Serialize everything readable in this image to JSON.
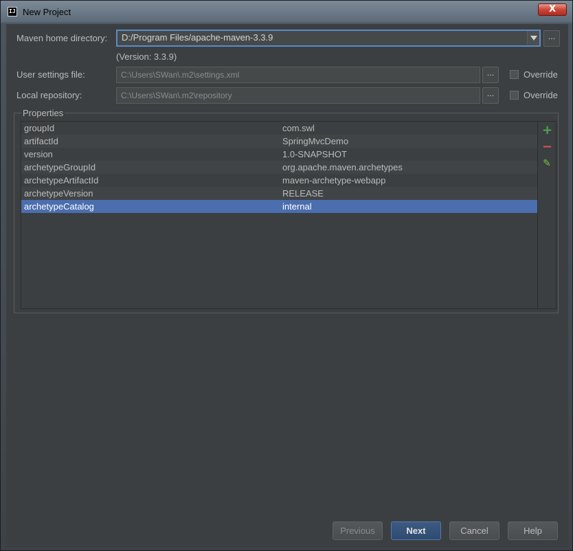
{
  "window": {
    "title": "New Project",
    "close_label": "X"
  },
  "maven_home": {
    "label": "Maven home directory:",
    "value": "D:/Program Files/apache-maven-3.3.9",
    "version": "(Version: 3.3.9)"
  },
  "user_settings": {
    "label": "User settings file:",
    "value": "C:\\Users\\SWan\\.m2\\settings.xml",
    "override_label": "Override"
  },
  "local_repo": {
    "label": "Local repository:",
    "value": "C:\\Users\\SWan\\.m2\\repository",
    "override_label": "Override"
  },
  "browse_label": "...",
  "properties": {
    "title": "Properties",
    "rows": [
      {
        "key": "groupId",
        "value": "com.swl"
      },
      {
        "key": "artifactId",
        "value": "SpringMvcDemo"
      },
      {
        "key": "version",
        "value": "1.0-SNAPSHOT"
      },
      {
        "key": "archetypeGroupId",
        "value": "org.apache.maven.archetypes"
      },
      {
        "key": "archetypeArtifactId",
        "value": "maven-archetype-webapp"
      },
      {
        "key": "archetypeVersion",
        "value": "RELEASE"
      },
      {
        "key": "archetypeCatalog",
        "value": "internal"
      }
    ],
    "selected_index": 6,
    "tools": {
      "add": "+",
      "remove": "−",
      "edit": "✎"
    }
  },
  "buttons": {
    "previous": "Previous",
    "next": "Next",
    "cancel": "Cancel",
    "help": "Help"
  },
  "colors": {
    "selection": "#4b6eaf",
    "add_icon": "#4ea84e",
    "remove_icon": "#d9534f",
    "edit_icon": "#7fbf3f"
  }
}
